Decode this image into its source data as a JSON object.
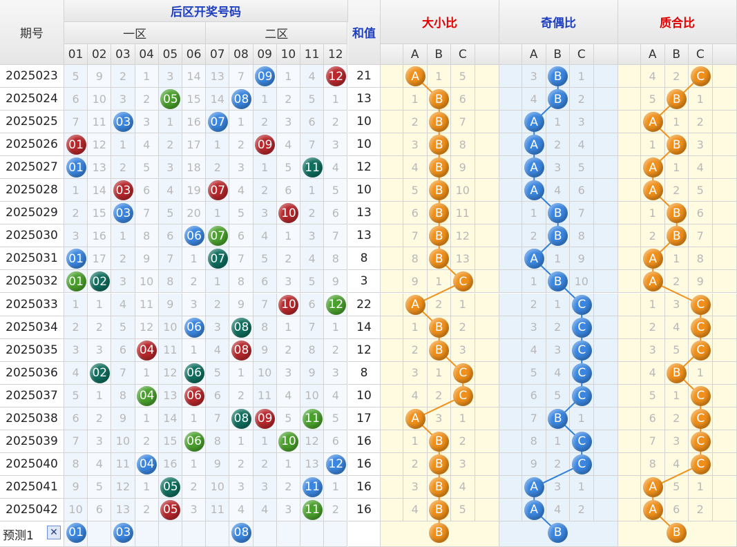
{
  "headers": {
    "period": "期号",
    "back_zone": "后区开奖号码",
    "zone1": "一区",
    "zone2": "二区",
    "sum": "和值",
    "ratio_titles": [
      "大小比",
      "奇偶比",
      "质合比"
    ],
    "abc": [
      "A",
      "B",
      "C"
    ],
    "numbers": [
      "01",
      "02",
      "03",
      "04",
      "05",
      "06",
      "07",
      "08",
      "09",
      "10",
      "11",
      "12"
    ]
  },
  "predict_label": "预测1",
  "close_glyph": "✕",
  "colors": {
    "ball_blue": "#3a86e0",
    "ball_red": "#b7272b",
    "ball_teal": "#0f6e5e",
    "ball_green": "#4aa02c",
    "ball_orange": "#f0901a",
    "line_orange": "#f0901a",
    "line_blue": "#2f7fd8",
    "run_gray": "#9b9b9b"
  },
  "chart_data": {
    "type": "table",
    "title": "",
    "rows": [
      {
        "period": "2025023",
        "cells": [
          "5",
          "9",
          "2",
          "1",
          "3",
          "14",
          "13",
          "7",
          "09",
          "1",
          "4",
          "12"
        ],
        "sum": "21",
        "r1": [
          "A",
          "1",
          "5"
        ],
        "r2": [
          "3",
          "B",
          "1"
        ],
        "r3": [
          "4",
          "2",
          "C"
        ]
      },
      {
        "period": "2025024",
        "cells": [
          "6",
          "10",
          "3",
          "2",
          "05",
          "15",
          "14",
          "08",
          "1",
          "2",
          "5",
          "1"
        ],
        "sum": "13",
        "r1": [
          "1",
          "B",
          "6"
        ],
        "r2": [
          "4",
          "B",
          "2"
        ],
        "r3": [
          "5",
          "B",
          "1"
        ]
      },
      {
        "period": "2025025",
        "cells": [
          "7",
          "11",
          "03",
          "3",
          "1",
          "16",
          "07",
          "1",
          "2",
          "3",
          "6",
          "2"
        ],
        "sum": "10",
        "r1": [
          "2",
          "B",
          "7"
        ],
        "r2": [
          "A",
          "1",
          "3"
        ],
        "r3": [
          "A",
          "1",
          "2"
        ]
      },
      {
        "period": "2025026",
        "cells": [
          "01",
          "12",
          "1",
          "4",
          "2",
          "17",
          "1",
          "2",
          "09",
          "4",
          "7",
          "3"
        ],
        "sum": "10",
        "r1": [
          "3",
          "B",
          "8"
        ],
        "r2": [
          "A",
          "2",
          "4"
        ],
        "r3": [
          "1",
          "B",
          "3"
        ]
      },
      {
        "period": "2025027",
        "cells": [
          "01",
          "13",
          "2",
          "5",
          "3",
          "18",
          "2",
          "3",
          "1",
          "5",
          "11",
          "4"
        ],
        "sum": "12",
        "r1": [
          "4",
          "B",
          "9"
        ],
        "r2": [
          "A",
          "3",
          "5"
        ],
        "r3": [
          "A",
          "1",
          "4"
        ]
      },
      {
        "period": "2025028",
        "cells": [
          "1",
          "14",
          "03",
          "6",
          "4",
          "19",
          "07",
          "4",
          "2",
          "6",
          "1",
          "5"
        ],
        "sum": "10",
        "r1": [
          "5",
          "B",
          "10"
        ],
        "r2": [
          "A",
          "4",
          "6"
        ],
        "r3": [
          "A",
          "2",
          "5"
        ]
      },
      {
        "period": "2025029",
        "cells": [
          "2",
          "15",
          "03",
          "7",
          "5",
          "20",
          "1",
          "5",
          "3",
          "10",
          "2",
          "6"
        ],
        "sum": "13",
        "r1": [
          "6",
          "B",
          "11"
        ],
        "r2": [
          "1",
          "B",
          "7"
        ],
        "r3": [
          "1",
          "B",
          "6"
        ]
      },
      {
        "period": "2025030",
        "cells": [
          "3",
          "16",
          "1",
          "8",
          "6",
          "06",
          "07",
          "6",
          "4",
          "1",
          "3",
          "7"
        ],
        "sum": "13",
        "r1": [
          "7",
          "B",
          "12"
        ],
        "r2": [
          "2",
          "B",
          "8"
        ],
        "r3": [
          "2",
          "B",
          "7"
        ]
      },
      {
        "period": "2025031",
        "cells": [
          "01",
          "17",
          "2",
          "9",
          "7",
          "1",
          "07",
          "7",
          "5",
          "2",
          "4",
          "8"
        ],
        "sum": "8",
        "r1": [
          "8",
          "B",
          "13"
        ],
        "r2": [
          "A",
          "1",
          "9"
        ],
        "r3": [
          "A",
          "1",
          "8"
        ]
      },
      {
        "period": "2025032",
        "cells": [
          "01",
          "02",
          "3",
          "10",
          "8",
          "2",
          "1",
          "8",
          "6",
          "3",
          "5",
          "9"
        ],
        "sum": "3",
        "r1": [
          "9",
          "1",
          "C"
        ],
        "r2": [
          "1",
          "B",
          "10"
        ],
        "r3": [
          "A",
          "2",
          "9"
        ]
      },
      {
        "period": "2025033",
        "cells": [
          "1",
          "1",
          "4",
          "11",
          "9",
          "3",
          "2",
          "9",
          "7",
          "10",
          "6",
          "12"
        ],
        "sum": "22",
        "r1": [
          "A",
          "2",
          "1"
        ],
        "r2": [
          "2",
          "1",
          "C"
        ],
        "r3": [
          "1",
          "3",
          "C"
        ]
      },
      {
        "period": "2025034",
        "cells": [
          "2",
          "2",
          "5",
          "12",
          "10",
          "06",
          "3",
          "08",
          "8",
          "1",
          "7",
          "1"
        ],
        "sum": "14",
        "r1": [
          "1",
          "B",
          "2"
        ],
        "r2": [
          "3",
          "2",
          "C"
        ],
        "r3": [
          "2",
          "4",
          "C"
        ]
      },
      {
        "period": "2025035",
        "cells": [
          "3",
          "3",
          "6",
          "04",
          "11",
          "1",
          "4",
          "08",
          "9",
          "2",
          "8",
          "2"
        ],
        "sum": "12",
        "r1": [
          "2",
          "B",
          "3"
        ],
        "r2": [
          "4",
          "3",
          "C"
        ],
        "r3": [
          "3",
          "5",
          "C"
        ]
      },
      {
        "period": "2025036",
        "cells": [
          "4",
          "02",
          "7",
          "1",
          "12",
          "06",
          "5",
          "1",
          "10",
          "3",
          "9",
          "3"
        ],
        "sum": "8",
        "r1": [
          "3",
          "1",
          "C"
        ],
        "r2": [
          "5",
          "4",
          "C"
        ],
        "r3": [
          "4",
          "B",
          "1"
        ]
      },
      {
        "period": "2025037",
        "cells": [
          "5",
          "1",
          "8",
          "04",
          "13",
          "06",
          "6",
          "2",
          "11",
          "4",
          "10",
          "4"
        ],
        "sum": "10",
        "r1": [
          "4",
          "2",
          "C"
        ],
        "r2": [
          "6",
          "5",
          "C"
        ],
        "r3": [
          "5",
          "1",
          "C"
        ]
      },
      {
        "period": "2025038",
        "cells": [
          "6",
          "2",
          "9",
          "1",
          "14",
          "1",
          "7",
          "08",
          "09",
          "5",
          "11",
          "5"
        ],
        "sum": "17",
        "r1": [
          "A",
          "3",
          "1"
        ],
        "r2": [
          "7",
          "B",
          "1"
        ],
        "r3": [
          "6",
          "2",
          "C"
        ]
      },
      {
        "period": "2025039",
        "cells": [
          "7",
          "3",
          "10",
          "2",
          "15",
          "06",
          "8",
          "1",
          "1",
          "10",
          "12",
          "6"
        ],
        "sum": "16",
        "r1": [
          "1",
          "B",
          "2"
        ],
        "r2": [
          "8",
          "1",
          "C"
        ],
        "r3": [
          "7",
          "3",
          "C"
        ]
      },
      {
        "period": "2025040",
        "cells": [
          "8",
          "4",
          "11",
          "04",
          "16",
          "1",
          "9",
          "2",
          "2",
          "1",
          "13",
          "12"
        ],
        "sum": "16",
        "r1": [
          "2",
          "B",
          "3"
        ],
        "r2": [
          "9",
          "2",
          "C"
        ],
        "r3": [
          "8",
          "4",
          "C"
        ]
      },
      {
        "period": "2025041",
        "cells": [
          "9",
          "5",
          "12",
          "1",
          "05",
          "2",
          "10",
          "3",
          "3",
          "2",
          "11",
          "1"
        ],
        "sum": "16",
        "r1": [
          "3",
          "B",
          "4"
        ],
        "r2": [
          "A",
          "3",
          "1"
        ],
        "r3": [
          "A",
          "5",
          "1"
        ]
      },
      {
        "period": "2025042",
        "cells": [
          "10",
          "6",
          "13",
          "2",
          "05",
          "3",
          "11",
          "4",
          "4",
          "3",
          "11",
          "2"
        ],
        "sum": "16",
        "r1": [
          "4",
          "B",
          "5"
        ],
        "r2": [
          "A",
          "4",
          "2"
        ],
        "r3": [
          "A",
          "6",
          "2"
        ]
      }
    ],
    "predict": {
      "cells": [
        "01",
        "",
        "03",
        "",
        "",
        "",
        "",
        "08",
        "",
        "",
        "",
        ""
      ],
      "r1": [
        "",
        "B",
        ""
      ],
      "r2": [
        "",
        "B",
        ""
      ],
      "r3": [
        "",
        "B",
        ""
      ]
    }
  }
}
